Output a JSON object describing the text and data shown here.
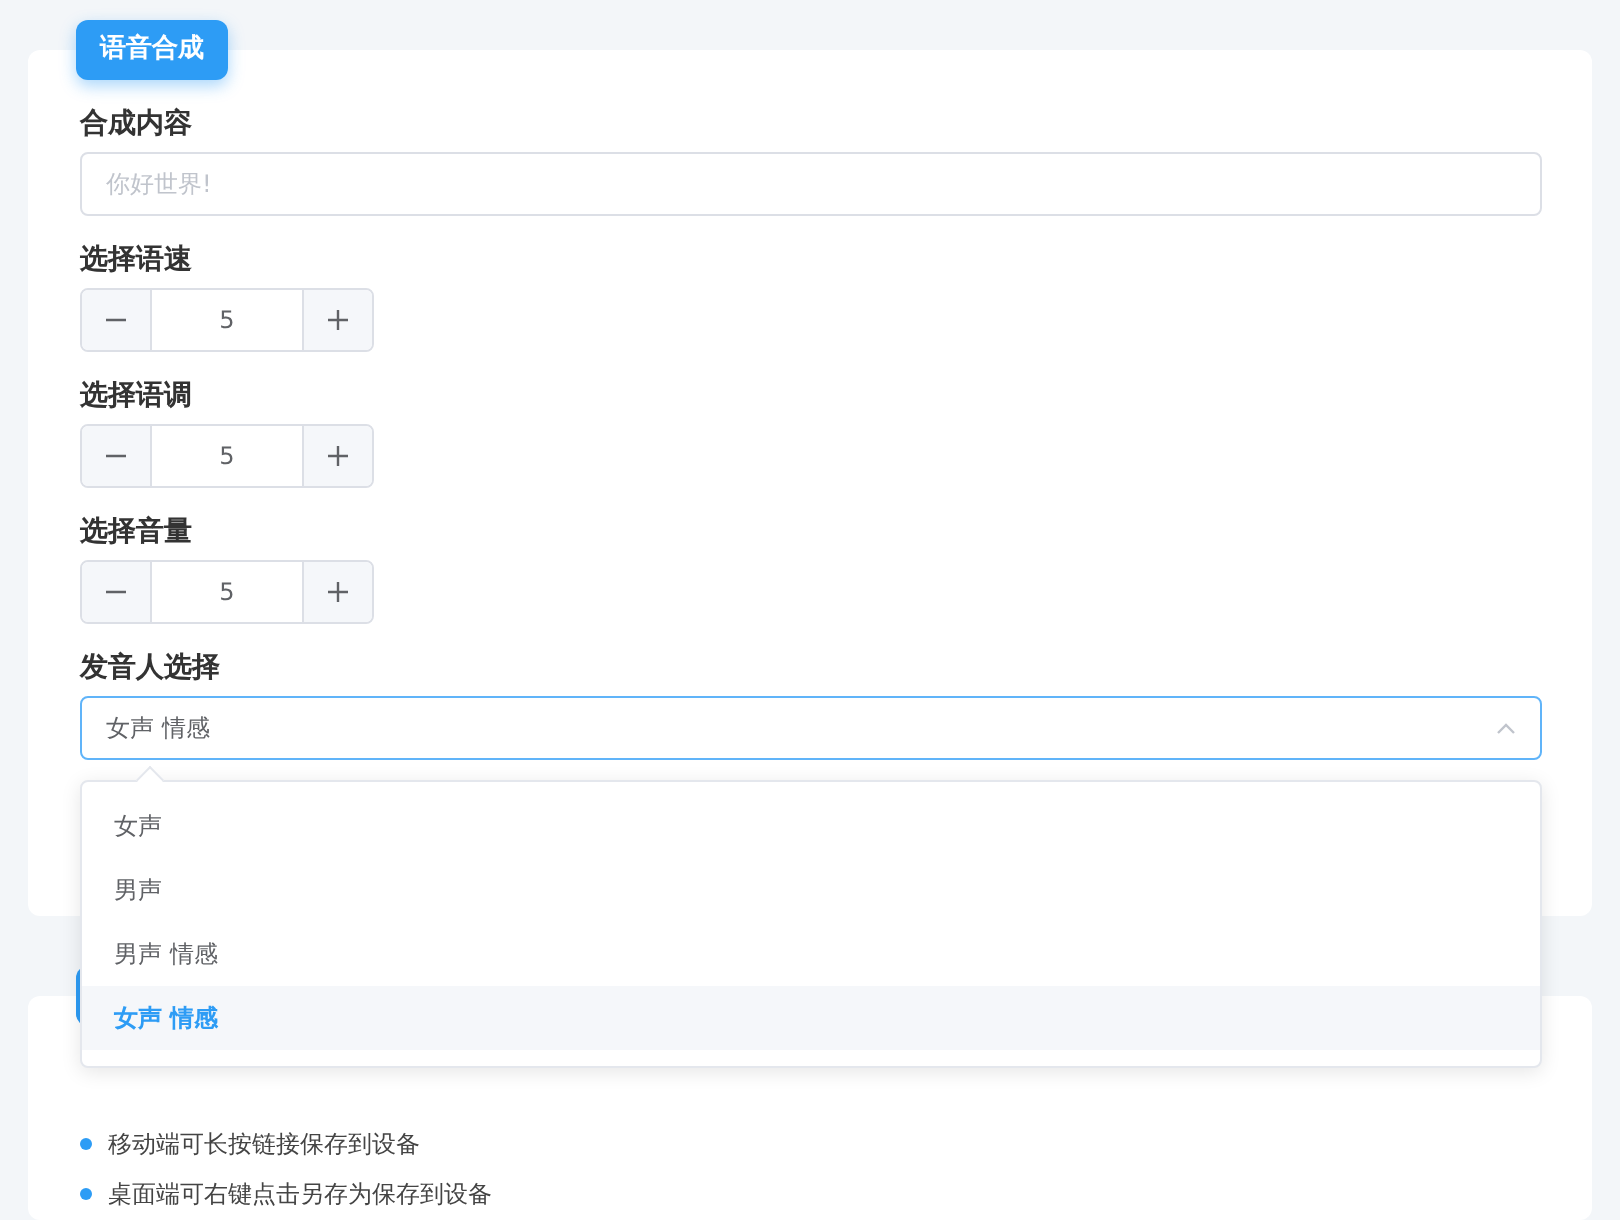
{
  "card": {
    "badge": "语音合成",
    "fields": [
      {
        "kind": "text",
        "label": "合成内容",
        "placeholder": "你好世界!"
      },
      {
        "kind": "stepper",
        "label": "选择语速",
        "value": "5"
      },
      {
        "kind": "stepper",
        "label": "选择语调",
        "value": "5"
      },
      {
        "kind": "stepper",
        "label": "选择音量",
        "value": "5"
      },
      {
        "kind": "select",
        "label": "发音人选择",
        "value": "女声 情感",
        "expanded": true,
        "options": [
          {
            "label": "女声",
            "selected": false
          },
          {
            "label": "男声",
            "selected": false
          },
          {
            "label": "男声 情感",
            "selected": false
          },
          {
            "label": "女声 情感",
            "selected": true
          }
        ]
      }
    ]
  },
  "notes": {
    "items": [
      "移动端可长按链接保存到设备",
      "桌面端可右键点击另存为保存到设备"
    ]
  }
}
